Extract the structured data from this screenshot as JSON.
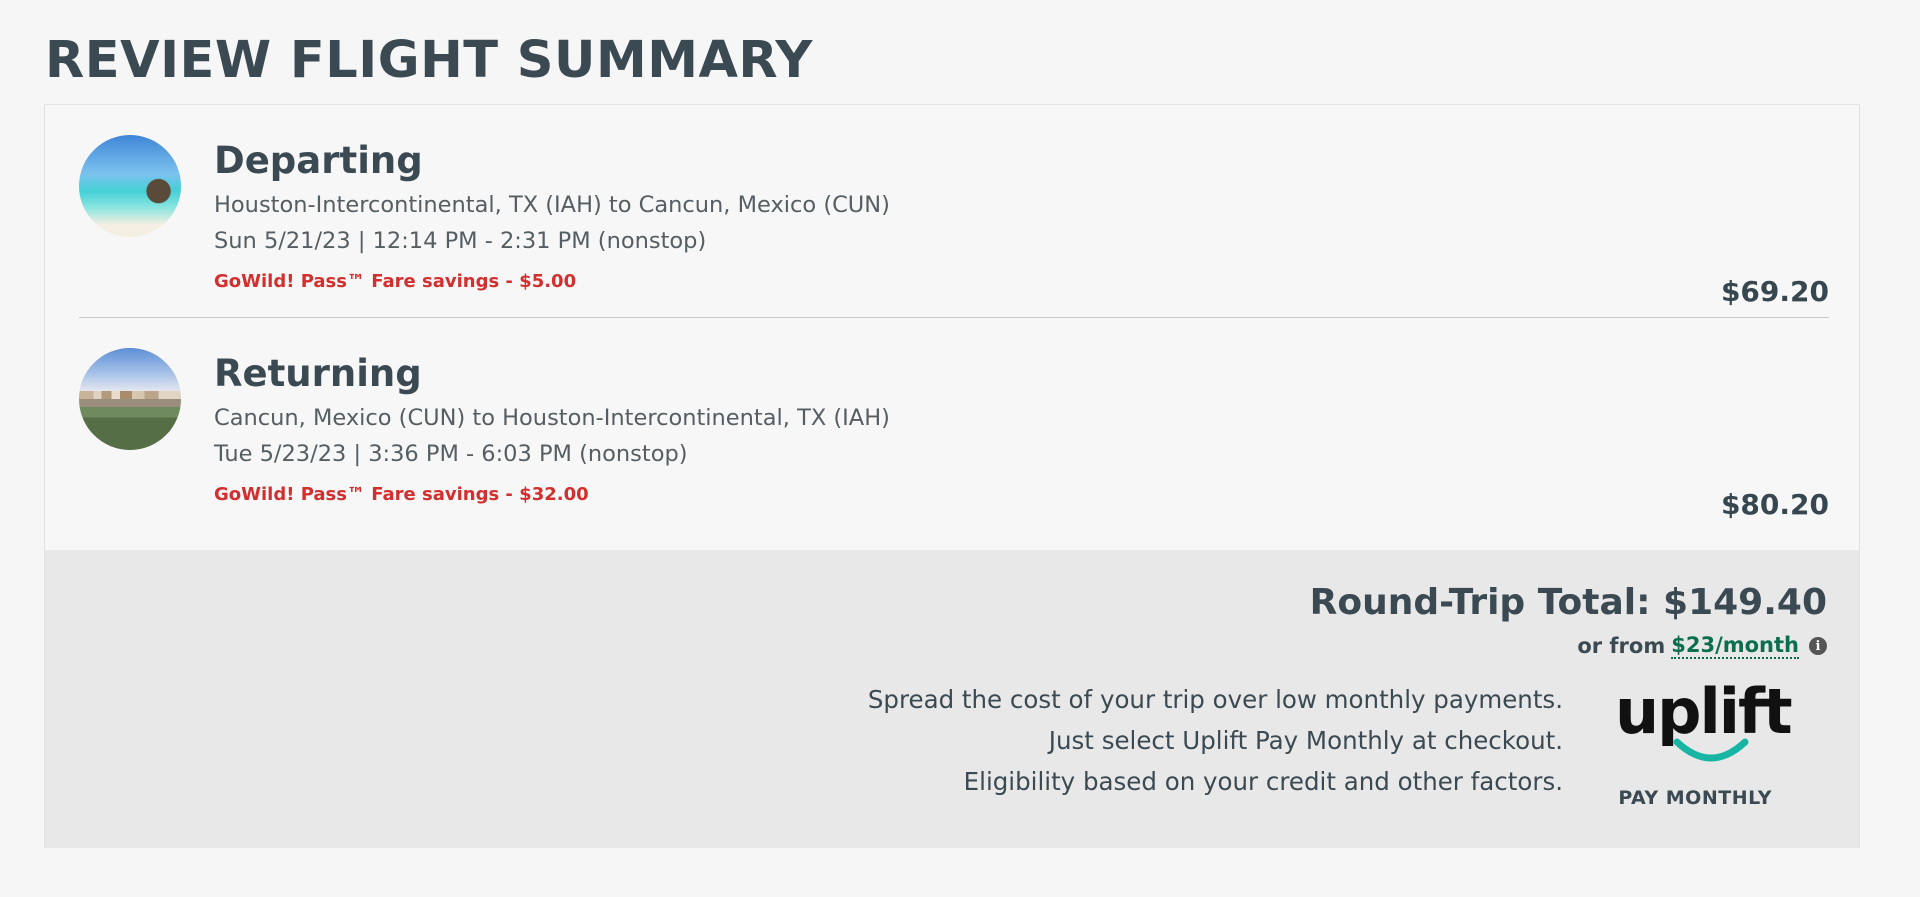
{
  "page": {
    "title": "REVIEW FLIGHT SUMMARY"
  },
  "legs": [
    {
      "heading": "Departing",
      "image_icon": "beach-photo",
      "route": "Houston-Intercontinental, TX (IAH) to Cancun, Mexico (CUN)",
      "times": "Sun 5/21/23 | 12:14 PM - 2:31 PM (nonstop)",
      "savings": "GoWild! Pass™ Fare savings - $5.00",
      "price": "$69.20"
    },
    {
      "heading": "Returning",
      "image_icon": "city-photo",
      "route": "Cancun, Mexico (CUN) to Houston-Intercontinental, TX (IAH)",
      "times": "Tue 5/23/23 | 3:36 PM - 6:03 PM (nonstop)",
      "savings": "GoWild! Pass™ Fare savings - $32.00",
      "price": "$80.20"
    }
  ],
  "total": {
    "label": "Round-Trip Total: $149.40",
    "monthly_prefix": "or from",
    "monthly_amount": "$23/month",
    "info_icon": "i"
  },
  "uplift": {
    "lines": [
      "Spread the cost of your trip over low monthly payments.",
      "Just select Uplift Pay Monthly at checkout.",
      "Eligibility based on your credit and other factors."
    ],
    "logo_text": "uplift",
    "tagline": "PAY MONTHLY"
  },
  "colors": {
    "heading": "#3b4a52",
    "savings": "#d32f2f",
    "link_green": "#0b6e4f",
    "uplift_teal": "#19b5a4"
  }
}
